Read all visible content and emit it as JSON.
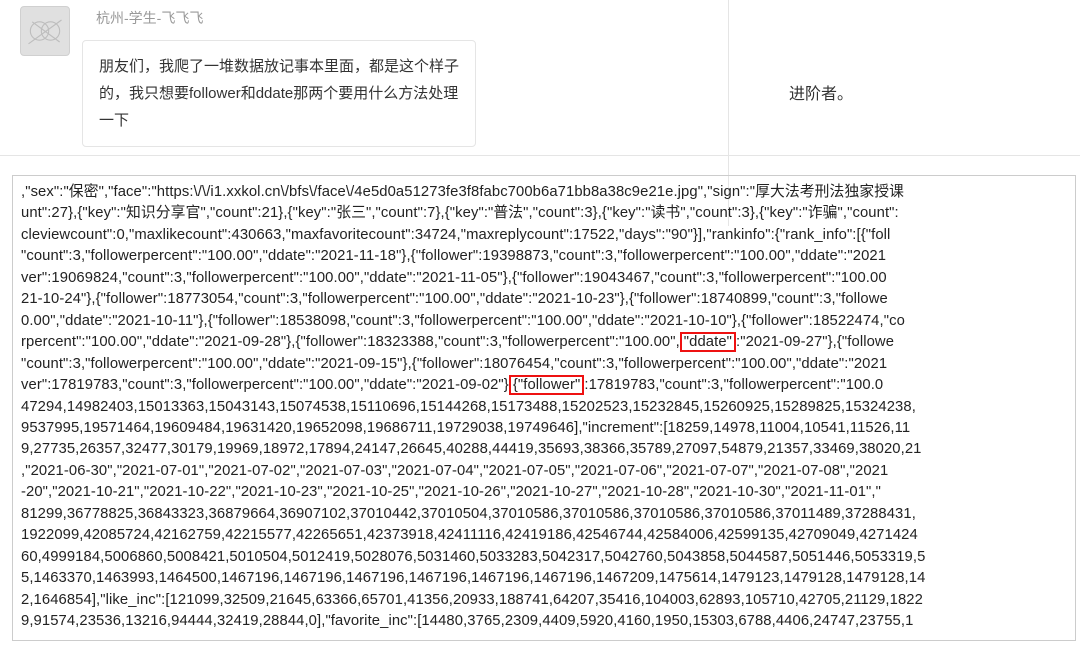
{
  "post": {
    "username": "杭州-学生-飞飞飞",
    "message": "朋友们，我爬了一堆数据放记事本里面，都是这个样子的，我只想要follower和ddate那两个要用什么方法处理一下"
  },
  "side_text": "进阶者。",
  "highlight": {
    "ddate": "\"ddate\"",
    "follower": "{\"follower\""
  },
  "lines": {
    "l1": ",\"sex\":\"保密\",\"face\":\"https:\\/\\/i1.xxkol.cn\\/bfs\\/face\\/4e5d0a51273fe3f8fabc700b6a71bb8a38c9e21e.jpg\",\"sign\":\"厚大法考刑法独家授课",
    "l2": "unt\":27},{\"key\":\"知识分享官\",\"count\":21},{\"key\":\"张三\",\"count\":7},{\"key\":\"普法\",\"count\":3},{\"key\":\"读书\",\"count\":3},{\"key\":\"诈骗\",\"count\":",
    "l3": "cleviewcount\":0,\"maxlikecount\":430663,\"maxfavoritecount\":34724,\"maxreplycount\":17522,\"days\":\"90\"}],\"rankinfo\":{\"rank_info\":[{\"foll",
    "l4": "\"count\":3,\"followerpercent\":\"100.00\",\"ddate\":\"2021-11-18\"},{\"follower\":19398873,\"count\":3,\"followerpercent\":\"100.00\",\"ddate\":\"2021",
    "l5": "ver\":19069824,\"count\":3,\"followerpercent\":\"100.00\",\"ddate\":\"2021-11-05\"},{\"follower\":19043467,\"count\":3,\"followerpercent\":\"100.00",
    "l6": "21-10-24\"},{\"follower\":18773054,\"count\":3,\"followerpercent\":\"100.00\",\"ddate\":\"2021-10-23\"},{\"follower\":18740899,\"count\":3,\"followe",
    "l7a": "0.00\",\"ddate\":\"2021-10-11\"},{\"follower\":18538098,\"count\":3,\"followerpercent\":\"100.00\",\"ddate\":\"2021-10-10\"",
    "l7b": "},{\"follower\":18522474,\"co",
    "l8a": "rpercent\":\"100.00\",\"ddate\":\"2021-09-28\"},{\"follower\":18323388,\"count\":3,\"followerpercent\":\"100.00\",",
    "l8b": ":\"2021-09-27\"},{\"followe",
    "l9": "\"count\":3,\"followerpercent\":\"100.00\",\"ddate\":\"2021-09-15\"},{\"follower\":18076454,\"count\":3,\"followerpercent\":\"100.00\",\"ddate\":\"2021",
    "l10a": "ver\":17819783,\"count\":3,\"followerpercent\":\"100.00\",\"ddate\":\"2021-09-02\"}",
    "l10b": ":17819783,\"count\":3,\"followerpercent\":\"100.0",
    "l11": "47294,14982403,15013363,15043143,15074538,15110696,15144268,15173488,15202523,15232845,15260925,15289825,15324238,",
    "l12": "9537995,19571464,19609484,19631420,19652098,19686711,19729038,19749646],\"increment\":[18259,14978,11004,10541,11526,11",
    "l13": "9,27735,26357,32477,30179,19969,18972,17894,24147,26645,40288,44419,35693,38366,35789,27097,54879,21357,33469,38020,21",
    "l14": ",\"2021-06-30\",\"2021-07-01\",\"2021-07-02\",\"2021-07-03\",\"2021-07-04\",\"2021-07-05\",\"2021-07-06\",\"2021-07-07\",\"2021-07-08\",\"2021",
    "l15": "-20\",\"2021-10-21\",\"2021-10-22\",\"2021-10-23\",\"2021-10-25\",\"2021-10-26\",\"2021-10-27\",\"2021-10-28\",\"2021-10-30\",\"2021-11-01\",\"",
    "l16": "81299,36778825,36843323,36879664,36907102,37010442,37010504,37010586,37010586,37010586,37010586,37011489,37288431,",
    "l17": "1922099,42085724,42162759,42215577,42265651,42373918,42411116,42419186,42546744,42584006,42599135,42709049,4271424",
    "l18": "60,4999184,5006860,5008421,5010504,5012419,5028076,5031460,5033283,5042317,5042760,5043858,5044587,5051446,5053319,5",
    "l19": "5,1463370,1463993,1464500,1467196,1467196,1467196,1467196,1467196,1467196,1467209,1475614,1479123,1479128,1479128,14",
    "l20": "2,1646854],\"like_inc\":[121099,32509,21645,63366,65701,41356,20933,188741,64207,35416,104003,62893,105710,42705,21129,1822",
    "l21": "9,91574,23536,13216,94444,32419,28844,0],\"favorite_inc\":[14480,3765,2309,4409,5920,4160,1950,15303,6788,4406,24747,23755,1"
  }
}
